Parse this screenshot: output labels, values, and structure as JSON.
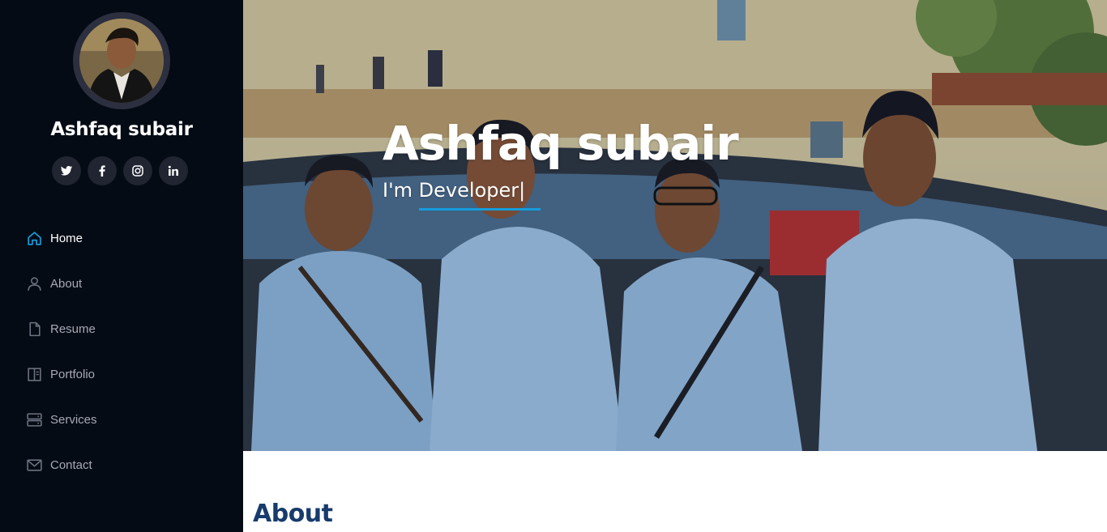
{
  "profile": {
    "name": "Ashfaq subair"
  },
  "social": [
    {
      "icon": "twitter-icon"
    },
    {
      "icon": "facebook-icon"
    },
    {
      "icon": "instagram-icon"
    },
    {
      "icon": "linkedin-icon"
    }
  ],
  "nav": {
    "items": [
      {
        "label": "Home",
        "icon": "home-icon",
        "active": true
      },
      {
        "label": "About",
        "icon": "person-icon"
      },
      {
        "label": "Resume",
        "icon": "file-icon"
      },
      {
        "label": "Portfolio",
        "icon": "portfolio-icon"
      },
      {
        "label": "Services",
        "icon": "server-icon"
      },
      {
        "label": "Contact",
        "icon": "envelope-icon"
      }
    ]
  },
  "hero": {
    "title": "Ashfaq subair",
    "subtitle": "I'm Developer|"
  },
  "about": {
    "title": "About"
  },
  "colors": {
    "sidebar_bg": "#040b14",
    "accent": "#149ddd",
    "section_title": "#173b6c"
  }
}
